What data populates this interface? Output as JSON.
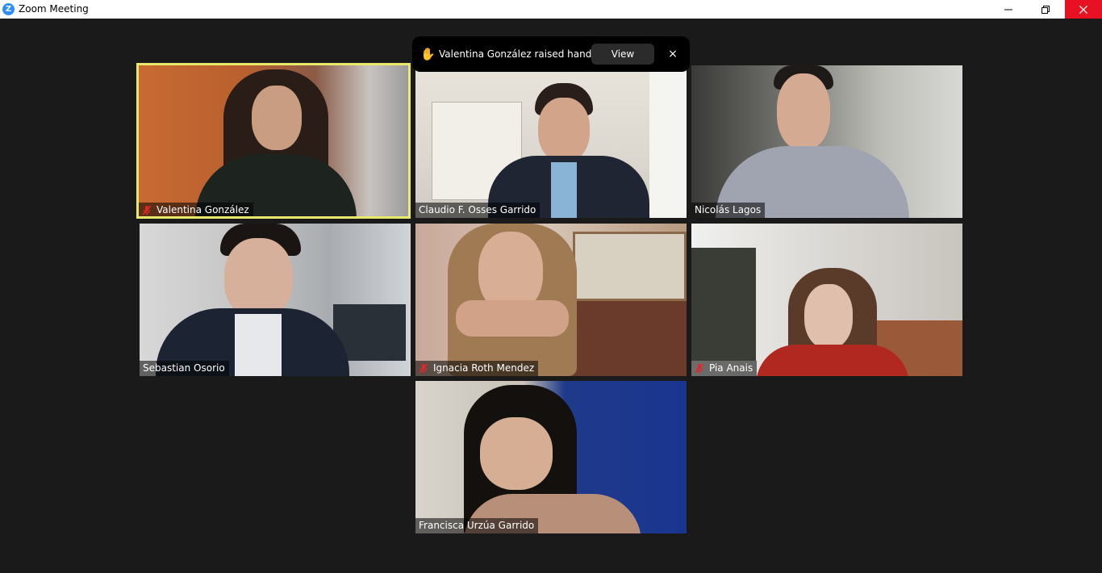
{
  "window": {
    "title": "Zoom Meeting",
    "logo_letter": "Z",
    "controls": {
      "minimize": "—",
      "close": "✕"
    }
  },
  "notification": {
    "icon": "raised-hand-icon",
    "message": "Valentina González raised hand",
    "view_label": "View",
    "close_label": "×"
  },
  "participants": [
    {
      "name": "Valentina González",
      "muted": true,
      "active_speaker": true
    },
    {
      "name": "Claudio F. Osses Garrido",
      "muted": false
    },
    {
      "name": "Nicolás Lagos",
      "muted": false
    },
    {
      "name": "Sebastian Osorio",
      "muted": false
    },
    {
      "name": "Ignacia Roth Mendez",
      "muted": true
    },
    {
      "name": "Pia Anais",
      "muted": true
    },
    {
      "name": "Francisca Urzúa Garrido",
      "muted": false
    }
  ],
  "colors": {
    "background": "#1a1a1a",
    "active_speaker_border": "#e8e86a",
    "muted_icon": "#e02828",
    "zoom_blue": "#2d8cff",
    "close_red": "#e81123"
  }
}
